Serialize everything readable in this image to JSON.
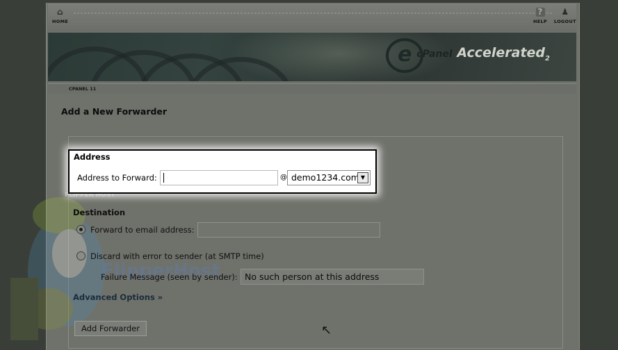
{
  "topbar": {
    "home_label": "HOME",
    "help_label": "HELP",
    "logout_label": "LOGOUT",
    "icons": {
      "home": "home-icon",
      "help": "question-icon",
      "logout": "person-icon"
    }
  },
  "banner": {
    "brand": "cPanel",
    "brand_accent": "Accelerated",
    "brand_version": "2",
    "logo_letter": "e"
  },
  "breadcrumb": "CPANEL 11",
  "page": {
    "title": "Add a New Forwarder"
  },
  "address": {
    "section_title": "Address",
    "label": "Address to Forward:",
    "input_value": "",
    "at_sign": "@",
    "domain_selected": "demo1234.com"
  },
  "destination": {
    "section_title": "Destination",
    "forward_label": "Forward to email address:",
    "forward_value": "",
    "discard_label": "Discard with error to sender (at SMTP time)",
    "failure_label": "Failure Message (seen by sender):",
    "failure_value": "No such person at this address"
  },
  "advanced_label": "Advanced Options »",
  "submit_label": "Add Forwarder",
  "watermark": {
    "badge": "FLIPPER HOST",
    "text": "FlipperHost"
  },
  "colors": {
    "highlight_border": "#000000",
    "dim_background": "#6f716b"
  }
}
